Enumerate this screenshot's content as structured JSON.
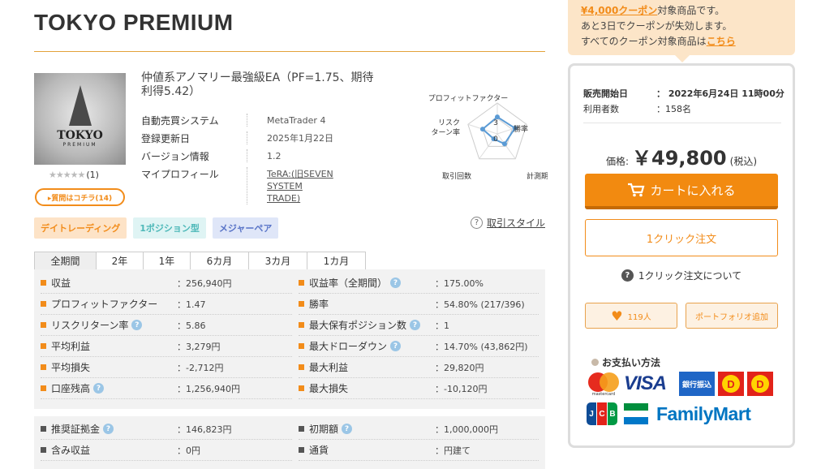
{
  "product": {
    "title": "TOKYO PREMIUM",
    "thumb_text_main": "TOKYO",
    "thumb_text_sub": "PREMIUM",
    "stars": "★★★★★",
    "review_count": "(1)",
    "questions_button": "▸質問はコチラ(14)",
    "ea_name": "仲値系アノマリー最強級EA（PF=1.75、期待利得5.42）"
  },
  "info": [
    {
      "label": "自動売買システム",
      "value": "MetaTrader 4"
    },
    {
      "label": "登録更新日",
      "value": "2025年1月22日"
    },
    {
      "label": "バージョン情報",
      "value": "1.2"
    },
    {
      "label": "マイプロフィール",
      "value": "TeRA:(旧SEVEN SYSTEM TRADE)"
    }
  ],
  "radar": {
    "axes": [
      "プロフィットファクター",
      "勝率",
      "計測期間",
      "取引回数",
      "リスク\nターン率"
    ],
    "axis_label_1": "プロフィットファクター",
    "axis_label_2": "勝率",
    "axis_label_3": "計測期間",
    "axis_label_4": "取引回数",
    "axis_label_5a": "リスク",
    "axis_label_5b": "ターン率",
    "scale_3": "3",
    "scale_0": "0",
    "levels": [
      0.55,
      0.6,
      0.4,
      0.2,
      0.5
    ]
  },
  "tags": [
    "デイトレーディング",
    "1ポジション型",
    "メジャーペア"
  ],
  "trade_style_link": "取引スタイル",
  "tabs": [
    "全期間",
    "2年",
    "1年",
    "6カ月",
    "3カ月",
    "1カ月"
  ],
  "stats_left": [
    {
      "label": "収益",
      "value": "：256,940円",
      "hint": false
    },
    {
      "label": "プロフィットファクター",
      "value": "：1.47",
      "hint": false
    },
    {
      "label": "リスクリターン率",
      "value": "：5.86",
      "hint": true
    },
    {
      "label": "平均利益",
      "value": "：3,279円",
      "hint": false
    },
    {
      "label": "平均損失",
      "value": "：-2,712円",
      "hint": false
    },
    {
      "label": "口座残高",
      "value": "：1,256,940円",
      "hint": true
    }
  ],
  "stats_right": [
    {
      "label": "収益率（全期間）",
      "value": "：175.00%",
      "hint": true
    },
    {
      "label": "勝率",
      "value": "：54.80% (217/396)",
      "hint": false
    },
    {
      "label": "最大保有ポジション数",
      "value": "：1",
      "hint": true
    },
    {
      "label": "最大ドローダウン",
      "value": "：14.70% (43,862円)",
      "hint": true
    },
    {
      "label": "最大利益",
      "value": "：29,820円",
      "hint": false
    },
    {
      "label": "最大損失",
      "value": "：-10,120円",
      "hint": false
    }
  ],
  "stats2_left": [
    {
      "label": "推奨証拠金",
      "value": "：146,823円",
      "hint": true
    },
    {
      "label": "含み収益",
      "value": "：0円",
      "hint": false
    }
  ],
  "stats2_right": [
    {
      "label": "初期額",
      "value": "：1,000,000円",
      "hint": true
    },
    {
      "label": "通貨",
      "value": "：円建て",
      "hint": false
    }
  ],
  "coupon": {
    "amount": "¥4,000クーポン",
    "line1_rest": "対象商品です。",
    "line2": "あと3日でクーポンが失効します。",
    "line3": "すべてのクーポン対象商品は",
    "link": "こちら"
  },
  "sale": {
    "start_label": "販売開始日",
    "start_value": "：  2022年6月24日 11時00分",
    "users_label": "利用者数",
    "users_value": "：158名",
    "price_label": "価格:",
    "price_value": "￥49,800",
    "tax": "(税込)",
    "cart_button": "カートに入れる",
    "oneclick_button": "1クリック注文",
    "about_oneclick": "1クリック注文について",
    "favorite_count": "119人",
    "portfolio_button": "ポートフォリオ追加",
    "payment_heading": "お支払い方法",
    "payment_labels": [
      "mastercard",
      "VISA",
      "銀行振込",
      "D",
      "D",
      "JCB",
      "FamilyMart"
    ]
  },
  "colors": {
    "accent": "#f28c1a",
    "coupon_bg": "#fce5c8",
    "rule": "#e3a23a"
  }
}
